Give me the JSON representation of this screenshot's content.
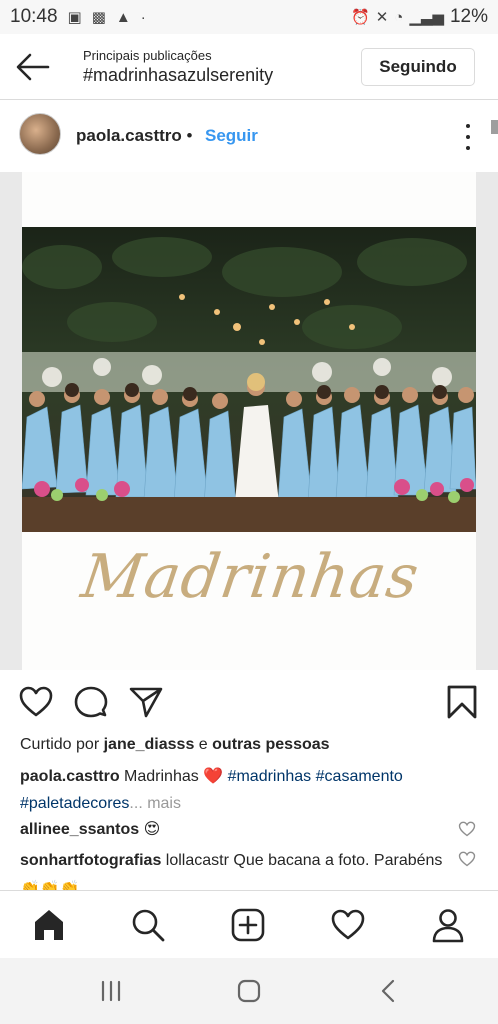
{
  "status_bar": {
    "time": "10:48",
    "battery": "12%",
    "left_icons": [
      "gallery-icon",
      "image-icon",
      "warning-icon",
      "dot-icon"
    ],
    "right_icons": [
      "alarm-icon",
      "mute-icon",
      "wifi-icon",
      "signal-icon",
      "battery-icon"
    ]
  },
  "header": {
    "subtitle": "Principais publicações",
    "hashtag": "#madrinhasazulserenity",
    "follow_label": "Seguindo"
  },
  "post": {
    "username": "paola.casttro",
    "separator": "•",
    "follow_label": "Seguir",
    "image_caption_script": "Madrinhas"
  },
  "likes": {
    "prefix": "Curtido por",
    "user": "jane_diasss",
    "connector": "e",
    "others": "outras pessoas"
  },
  "caption": {
    "user": "paola.casttro",
    "text": "Madrinhas",
    "emoji": "❤️",
    "tag1": "#madrinhas",
    "tag2": "#casamento",
    "tag3": "#paletadecores",
    "more": "... mais"
  },
  "comments": [
    {
      "user": "allinee_ssantos",
      "text": "😍"
    },
    {
      "user": "sonhartfotografias",
      "text": "lollacastr Que bacana a foto. Parabéns 👏👏👏"
    }
  ],
  "tabs": [
    "home-icon",
    "search-icon",
    "new-post-icon",
    "activity-icon",
    "profile-icon"
  ],
  "colors": {
    "link_blue": "#3897f0",
    "hashtag_blue": "#003569",
    "gold_script": "#c8ad7f",
    "dress_blue": "#8fc3e3"
  }
}
